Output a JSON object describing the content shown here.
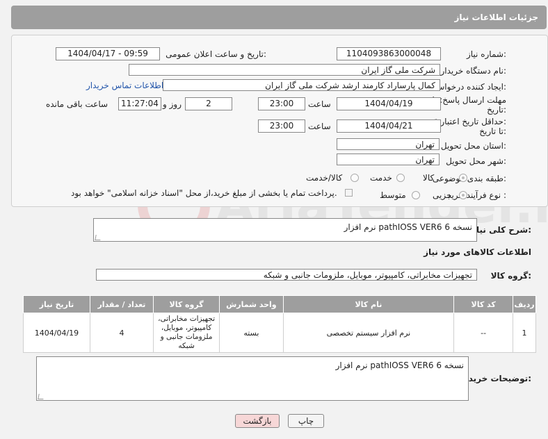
{
  "header": {
    "title": "جزئیات اطلاعات نیاز"
  },
  "form": {
    "need_number_label": "شماره نیاز:",
    "need_number": "1104093863000048",
    "announce_label": "تاریخ و ساعت اعلان عمومی:",
    "announce_value": "1404/04/17 - 09:59",
    "buyer_org_label": "نام دستگاه خریدار:",
    "buyer_org": "شرکت ملی گاز ایران",
    "requester_label": "ایجاد کننده درخواست:",
    "requester": "کمال پارساراد کارمند ارشد شرکت ملی گاز ایران",
    "contact_link": "اطلاعات تماس خریدار",
    "deadline_label_1": "مهلت ارسال پاسخ: تا",
    "deadline_label_2": "تاریخ:",
    "deadline_date": "1404/04/19",
    "time_label": "ساعت",
    "deadline_time": "23:00",
    "days_value": "2",
    "days_label": "روز و",
    "remaining_time": "11:27:04",
    "remaining_label": "ساعت باقی مانده",
    "validity_label_1": "حداقل تاریخ اعتبار قیمت:",
    "validity_label_2": "تا تاریخ:",
    "validity_date": "1404/04/21",
    "validity_time": "23:00",
    "province_label": "استان محل تحویل:",
    "province": "تهران",
    "city_label": "شهر محل تحویل:",
    "city": "تهران",
    "category_label": "طبقه بندی موضوعی:",
    "category_options": [
      "کالا",
      "خدمت",
      "کالا/خدمت"
    ],
    "process_label": "نوع فرآیند خرید :",
    "process_options": [
      "جزیی",
      "متوسط"
    ],
    "payment_note": "پرداخت تمام یا بخشی از مبلغ خرید،از محل \"اسناد خزانه اسلامی\" خواهد بود."
  },
  "summary": {
    "label": "شرح کلی نیاز:",
    "text": "نرم افزار pathIOSS VER6 نسخه 6"
  },
  "goods": {
    "section_title": "اطلاعات کالاهای مورد نیاز",
    "group_label": "گروه کالا:",
    "group_value": "تجهیزات مخابراتی، کامپیوتر، موبایل، ملزومات جانبی و شبکه"
  },
  "table": {
    "headers": [
      "ردیف",
      "کد کالا",
      "نام کالا",
      "واحد شمارش",
      "گروه کالا",
      "تعداد / مقدار",
      "تاریخ نیاز"
    ],
    "rows": [
      [
        "1",
        "--",
        "نرم افزار سیستم تخصصی",
        "بسته",
        "تجهیزات مخابراتی، کامپیوتر، موبایل، ملزومات جانبی و شبکه",
        "4",
        "1404/04/19"
      ]
    ]
  },
  "buyer_notes": {
    "label": "توضیحات خریدار:",
    "text": "نرم افزار pathIOSS VER6 نسخه 6"
  },
  "buttons": {
    "print": "چاپ",
    "back": "بازگشت"
  },
  "colors": {
    "header": "#9e9e9e",
    "link": "#2255aa",
    "back_button": "#f7d7d7"
  }
}
